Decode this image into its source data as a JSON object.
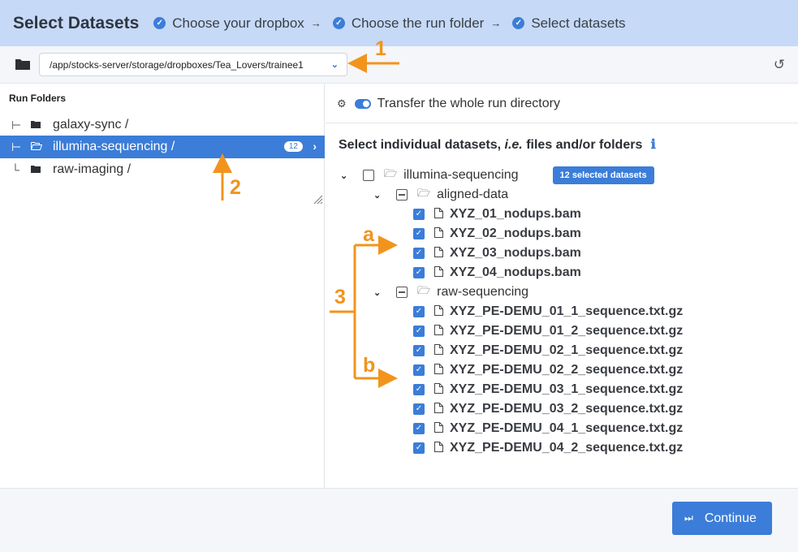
{
  "header": {
    "title": "Select Datasets",
    "steps": [
      {
        "label": "Choose your dropbox"
      },
      {
        "label": "Choose the run folder"
      },
      {
        "label": "Select datasets"
      }
    ],
    "step_arrow": "→"
  },
  "dropbox": {
    "path": "/app/stocks-server/storage/dropboxes/Tea_Lovers/trainee1"
  },
  "run_folders": {
    "header": "Run Folders",
    "items": [
      {
        "label": "galaxy-sync /"
      },
      {
        "label": "illumina-sequencing /",
        "count": "12"
      },
      {
        "label": "raw-imaging /"
      }
    ]
  },
  "transfer": {
    "label": "Transfer the whole run directory"
  },
  "selection": {
    "title_pre": "Select individual datasets, ",
    "title_ie": "i.e.",
    "title_post": " files and/or folders",
    "root": "illumina-sequencing",
    "badge": "12 selected datasets",
    "folder_a": "aligned-data",
    "folder_b": "raw-sequencing",
    "files_a": [
      "XYZ_01_nodups.bam",
      "XYZ_02_nodups.bam",
      "XYZ_03_nodups.bam",
      "XYZ_04_nodups.bam"
    ],
    "files_b": [
      "XYZ_PE-DEMU_01_1_sequence.txt.gz",
      "XYZ_PE-DEMU_01_2_sequence.txt.gz",
      "XYZ_PE-DEMU_02_1_sequence.txt.gz",
      "XYZ_PE-DEMU_02_2_sequence.txt.gz",
      "XYZ_PE-DEMU_03_1_sequence.txt.gz",
      "XYZ_PE-DEMU_03_2_sequence.txt.gz",
      "XYZ_PE-DEMU_04_1_sequence.txt.gz",
      "XYZ_PE-DEMU_04_2_sequence.txt.gz"
    ]
  },
  "footer": {
    "continue": "Continue"
  },
  "annotations": {
    "n1": "1",
    "n2": "2",
    "n3": "3",
    "a": "a",
    "b": "b"
  },
  "colors": {
    "accent": "#3b7dd8",
    "header_bg": "#c6d9f7",
    "annotation": "#f2941c"
  }
}
